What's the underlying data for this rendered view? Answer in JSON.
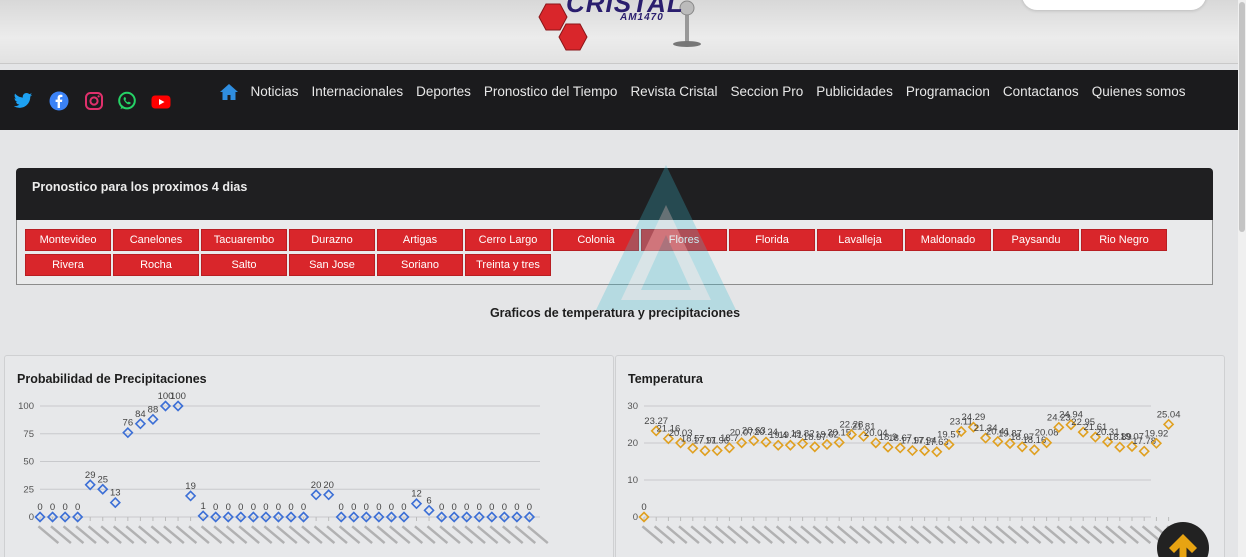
{
  "header": {
    "logo_text": "CRISTAL",
    "logo_sub": "AM1470"
  },
  "navbar": {
    "social": [
      {
        "icon": "twitter-icon",
        "color": "#1da1f2"
      },
      {
        "icon": "facebook-icon",
        "color": "#1877f2"
      },
      {
        "icon": "instagram-icon",
        "color": "#e1306c"
      },
      {
        "icon": "whatsapp-icon",
        "color": "#25d366"
      },
      {
        "icon": "youtube-icon",
        "color": "#ff0000"
      }
    ],
    "home_icon_color": "#2f8ee0",
    "links": [
      "Noticias",
      "Internacionales",
      "Deportes",
      "Pronostico del Tiempo",
      "Revista Cristal",
      "Seccion Pro",
      "Publicidades",
      "Programacion",
      "Contactanos",
      "Quienes somos"
    ]
  },
  "forecast": {
    "title": "Pronostico para los proximos 4 dias",
    "cities": [
      "Montevideo",
      "Canelones",
      "Tacuarembo",
      "Durazno",
      "Artigas",
      "Cerro Largo",
      "Colonia",
      "Flores",
      "Florida",
      "Lavalleja",
      "Maldonado",
      "Paysandu",
      "Rio Negro",
      "Rivera",
      "Rocha",
      "Salto",
      "San Jose",
      "Soriano",
      "Treinta y tres"
    ],
    "button_color": "#d9262b"
  },
  "charts_section_title": "Graficos de temperatura y precipitaciones",
  "chart_data": [
    {
      "type": "scatter",
      "title": "Probabilidad de Precipitaciones",
      "ylim": [
        0,
        100
      ],
      "yticks": [
        0,
        25,
        50,
        75,
        100
      ],
      "color": "#3c6fd6",
      "values": [
        0,
        0,
        0,
        0,
        29,
        25,
        13,
        76,
        84,
        88,
        100,
        100,
        19,
        1,
        0,
        0,
        0,
        0,
        0,
        0,
        0,
        0,
        20,
        20,
        0,
        0,
        0,
        0,
        0,
        0,
        12,
        6,
        0,
        0,
        0,
        0,
        0,
        0,
        0,
        0
      ]
    },
    {
      "type": "scatter",
      "title": "Temperatura",
      "ylim": [
        0,
        30
      ],
      "yticks": [
        0,
        10,
        20,
        30
      ],
      "color": "#e0a020",
      "values": [
        0,
        23.27,
        21.16,
        20.03,
        18.57,
        17.91,
        17.96,
        18.7,
        20.07,
        20.63,
        20.24,
        19.4,
        19.41,
        19.82,
        18.97,
        19.62,
        20.15,
        22.28,
        21.81,
        20.04,
        18.9,
        18.67,
        17.97,
        17.94,
        17.63,
        19.57,
        23.11,
        24.29,
        21.34,
        20.41,
        19.87,
        18.97,
        18.16,
        20.08,
        24.23,
        24.94,
        22.95,
        21.61,
        20.31,
        18.89,
        19.07,
        17.78,
        19.92,
        25.04
      ]
    }
  ]
}
